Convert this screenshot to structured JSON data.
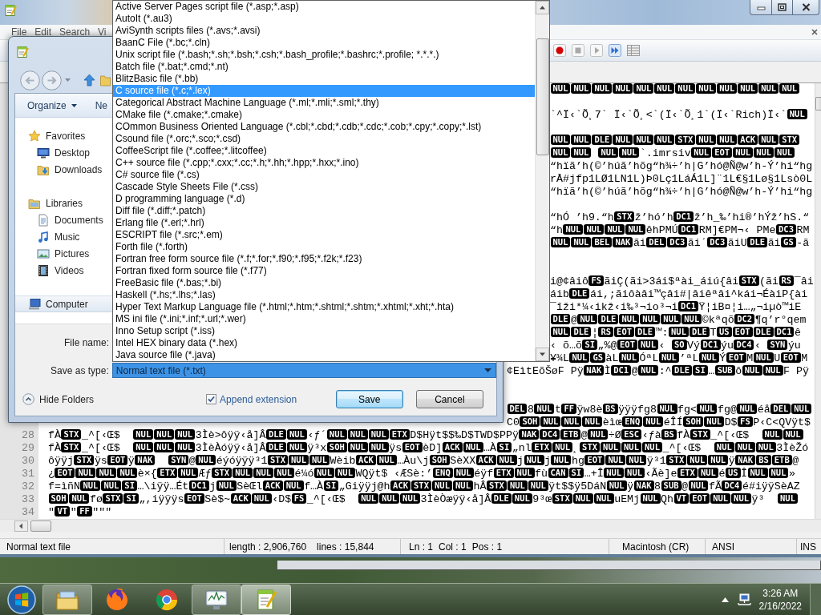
{
  "app": {
    "menu": [
      "File",
      "Edit",
      "Search",
      "Vi"
    ]
  },
  "toolbar": {
    "macro_buttons": [
      {
        "disabled": false
      },
      {
        "disabled": true
      },
      {
        "disabled": true
      },
      {
        "disabled": false
      },
      {
        "disabled": true
      }
    ]
  },
  "editor": {
    "lines": [
      {
        "kind": "code",
        "segments": [
          {
            "kind": "control",
            "text": "NUL"
          },
          {
            "kind": "control",
            "text": "NUL"
          },
          {
            "kind": "control",
            "text": "NUL"
          },
          {
            "kind": "control",
            "text": "NUL"
          },
          {
            "kind": "control",
            "text": "NUL"
          },
          {
            "kind": "control",
            "text": "NUL"
          },
          {
            "kind": "control",
            "text": "NUL"
          },
          {
            "kind": "control",
            "text": "NUL"
          },
          {
            "kind": "control",
            "text": "NUL"
          },
          {
            "kind": "control",
            "text": "NUL"
          },
          {
            "kind": "control",
            "text": "NUL"
          },
          {
            "kind": "control",
            "text": "NUL"
          }
        ]
      },
      {
        "kind": "blank"
      },
      {
        "kind": "code",
        "segments": [
          {
            "kind": "text",
            "text": "`^Ï‹`Õ¸7` Ï‹`Õ¸<`(Ï‹`Õ¸1`(Ï‹`Rich)Ï‹`"
          },
          {
            "kind": "control",
            "text": "NUL"
          }
        ]
      },
      {
        "kind": "blank"
      },
      {
        "kind": "code",
        "segments": [
          {
            "kind": "control",
            "text": "NUL"
          },
          {
            "kind": "control",
            "text": "NUL"
          },
          {
            "kind": "control",
            "text": "DLE"
          },
          {
            "kind": "control",
            "text": "NUL"
          },
          {
            "kind": "control",
            "text": "NUL"
          },
          {
            "kind": "control",
            "text": "NUL"
          },
          {
            "kind": "control",
            "text": "STX"
          },
          {
            "kind": "control",
            "text": "NUL"
          },
          {
            "kind": "control",
            "text": "NUL"
          },
          {
            "kind": "control",
            "text": "ACK"
          },
          {
            "kind": "control",
            "text": "NUL"
          },
          {
            "kind": "control",
            "text": "STX"
          }
        ]
      },
      {
        "kind": "code",
        "segments": [
          {
            "kind": "control",
            "text": "NUL"
          },
          {
            "kind": "control",
            "text": "NUL"
          },
          {
            "kind": "space"
          },
          {
            "kind": "control",
            "text": "NUL"
          },
          {
            "kind": "control",
            "text": "NUL"
          },
          {
            "kind": "text",
            "text": "`.imrsiv"
          },
          {
            "kind": "control",
            "text": "NUL"
          },
          {
            "kind": "control",
            "text": "EOT"
          },
          {
            "kind": "control",
            "text": "NUL"
          },
          {
            "kind": "control",
            "text": "NUL"
          },
          {
            "kind": "control",
            "text": "NUL"
          }
        ]
      },
      {
        "kind": "code",
        "segments": [
          {
            "kind": "text",
            "text": "“hïã’h(©’húã’hõg“h¾÷’h|G’hó@Ñ@w’h-Ý’hi“hg"
          }
        ]
      },
      {
        "kind": "code",
        "segments": [
          {
            "kind": "text",
            "text": "rÅ#jfp1LØ1LN1L)Þ0Lç1LáÁ1L]¨1L€§1Lø§1Lsò0L"
          }
        ]
      },
      {
        "kind": "code",
        "segments": [
          {
            "kind": "text",
            "text": "“hïã’h(©’húã’hõg“h¾÷’h|G’hó@Ñ@w’h-Ý’hi“hg"
          }
        ]
      },
      {
        "kind": "blank"
      },
      {
        "kind": "code",
        "segments": [
          {
            "kind": "text",
            "text": "“hÓ ’h9.“h"
          },
          {
            "kind": "control",
            "text": "STX"
          },
          {
            "kind": "text",
            "text": "ž’hó’h"
          },
          {
            "kind": "control",
            "text": "DC1"
          },
          {
            "kind": "text",
            "text": "ž’h_‰’hi®’hÝž’hS.“"
          }
        ]
      },
      {
        "kind": "code",
        "segments": [
          {
            "kind": "text",
            "text": "“h"
          },
          {
            "kind": "control",
            "text": "NUL"
          },
          {
            "kind": "control",
            "text": "NUL"
          },
          {
            "kind": "control",
            "text": "NUL"
          },
          {
            "kind": "control",
            "text": "NUL"
          },
          {
            "kind": "text",
            "text": "êhPMÚ"
          },
          {
            "kind": "control",
            "text": "DC1"
          },
          {
            "kind": "text",
            "text": "RM]€PM¬‹ PMe"
          },
          {
            "kind": "control",
            "text": "DC3"
          },
          {
            "kind": "text",
            "text": "RM"
          }
        ]
      },
      {
        "kind": "code",
        "segments": [
          {
            "kind": "control",
            "text": "NUL"
          },
          {
            "kind": "control",
            "text": "NUL"
          },
          {
            "kind": "control",
            "text": "BEL"
          },
          {
            "kind": "control",
            "text": "NAK"
          },
          {
            "kind": "text",
            "text": "ãi"
          },
          {
            "kind": "control",
            "text": "DEL"
          },
          {
            "kind": "control",
            "text": "DC3"
          },
          {
            "kind": "text",
            "text": "ãi´"
          },
          {
            "kind": "control",
            "text": "DC3"
          },
          {
            "kind": "text",
            "text": "ãiU"
          },
          {
            "kind": "control",
            "text": "DLE"
          },
          {
            "kind": "text",
            "text": "ãi"
          },
          {
            "kind": "control",
            "text": "GS"
          },
          {
            "kind": "text",
            "text": "-ã"
          }
        ]
      },
      {
        "kind": "blank"
      },
      {
        "kind": "blank"
      },
      {
        "kind": "code",
        "segments": [
          {
            "kind": "text",
            "text": "i@¢âiô"
          },
          {
            "kind": "control",
            "text": "FS"
          },
          {
            "kind": "text",
            "text": "ãiÇ(ãi>3ái$ªài_áiú{âi"
          },
          {
            "kind": "control",
            "text": "STX"
          },
          {
            "kind": "text",
            "text": "(ãi"
          },
          {
            "kind": "control",
            "text": "RS"
          },
          {
            "kind": "text",
            "text": "¯âi"
          }
        ]
      },
      {
        "kind": "code",
        "segments": [
          {
            "kind": "text",
            "text": "áib"
          },
          {
            "kind": "control",
            "text": "DLE"
          },
          {
            "kind": "text",
            "text": "ái,;ãiôàâi™çâi#|âiêªâi^kái¬ÉàiP{ài"
          }
        ]
      },
      {
        "kind": "code",
        "segments": [
          {
            "kind": "text",
            "text": "¯îži*¼‹ikž‹i‰³¬io³¬i"
          },
          {
            "kind": "control",
            "text": "DC1"
          },
          {
            "kind": "text",
            "text": "Ÿ¦iB¤¦i…„¬iµò™iE"
          }
        ]
      },
      {
        "kind": "code",
        "segments": [
          {
            "kind": "control",
            "text": "DLE"
          },
          {
            "kind": "text",
            "text": "@"
          },
          {
            "kind": "control",
            "text": "NUL"
          },
          {
            "kind": "control",
            "text": "DLE"
          },
          {
            "kind": "control",
            "text": "NUL"
          },
          {
            "kind": "control",
            "text": "NUL"
          },
          {
            "kind": "control",
            "text": "NUL"
          },
          {
            "kind": "control",
            "text": "NUL"
          },
          {
            "kind": "text",
            "text": "©kªqõ"
          },
          {
            "kind": "control",
            "text": "DC2"
          },
          {
            "kind": "text",
            "text": "¶q’r°qem"
          }
        ]
      },
      {
        "kind": "code",
        "segments": [
          {
            "kind": "control",
            "text": "NUL"
          },
          {
            "kind": "control",
            "text": "DLE"
          },
          {
            "kind": "text",
            "text": "¦"
          },
          {
            "kind": "control",
            "text": "RS"
          },
          {
            "kind": "control",
            "text": "EOT"
          },
          {
            "kind": "control",
            "text": "DLE"
          },
          {
            "kind": "text",
            "text": "™:"
          },
          {
            "kind": "control",
            "text": "NUL"
          },
          {
            "kind": "control",
            "text": "DLE"
          },
          {
            "kind": "text",
            "text": "T"
          },
          {
            "kind": "control",
            "text": "US"
          },
          {
            "kind": "control",
            "text": "EOT"
          },
          {
            "kind": "control",
            "text": "DLE"
          },
          {
            "kind": "control",
            "text": "DC1"
          },
          {
            "kind": "text",
            "text": "ê"
          }
        ]
      },
      {
        "kind": "code",
        "segments": [
          {
            "kind": "text",
            "text": "‹ õ…õ"
          },
          {
            "kind": "control",
            "text": "SI"
          },
          {
            "kind": "text",
            "text": "„%@"
          },
          {
            "kind": "control",
            "text": "EOT"
          },
          {
            "kind": "control",
            "text": "NUL"
          },
          {
            "kind": "text",
            "text": "‹ "
          },
          {
            "kind": "control",
            "text": "SO"
          },
          {
            "kind": "text",
            "text": "Vý"
          },
          {
            "kind": "control",
            "text": "DC1"
          },
          {
            "kind": "text",
            "text": "ýu"
          },
          {
            "kind": "control",
            "text": "DC4"
          },
          {
            "kind": "text",
            "text": "‹ "
          },
          {
            "kind": "control",
            "text": "SYN"
          },
          {
            "kind": "text",
            "text": "ýu"
          }
        ]
      },
      {
        "kind": "code",
        "segments": [
          {
            "kind": "text",
            "text": "¥¾L"
          },
          {
            "kind": "control",
            "text": "NUL"
          },
          {
            "kind": "control",
            "text": "GS"
          },
          {
            "kind": "text",
            "text": "àL"
          },
          {
            "kind": "control",
            "text": "NUL"
          },
          {
            "kind": "text",
            "text": "ÓªL"
          },
          {
            "kind": "control",
            "text": "NUL"
          },
          {
            "kind": "text",
            "text": "’ªL"
          },
          {
            "kind": "control",
            "text": "NUL"
          },
          {
            "kind": "text",
            "text": "Ý"
          },
          {
            "kind": "control",
            "text": "EOT"
          },
          {
            "kind": "text",
            "text": "M"
          },
          {
            "kind": "control",
            "text": "NUL"
          },
          {
            "kind": "text",
            "text": "U"
          },
          {
            "kind": "control",
            "text": "EOT"
          },
          {
            "kind": "text",
            "text": "M"
          }
        ]
      },
      {
        "kind": "code",
        "segments": [
          {
            "kind": "text",
            "text": "¢EìtEõŠøF Pÿ"
          },
          {
            "kind": "control",
            "text": "NAK"
          },
          {
            "kind": "text",
            "text": "Ì"
          },
          {
            "kind": "control",
            "text": "DC1"
          },
          {
            "kind": "text",
            "text": "@"
          },
          {
            "kind": "control",
            "text": "NUL"
          },
          {
            "kind": "text",
            "text": ":^"
          },
          {
            "kind": "control",
            "text": "DLE"
          },
          {
            "kind": "control",
            "text": "SI"
          },
          {
            "kind": "text",
            "text": "…"
          },
          {
            "kind": "control",
            "text": "SUB"
          },
          {
            "kind": "text",
            "text": "ô"
          },
          {
            "kind": "control",
            "text": "NUL"
          },
          {
            "kind": "control",
            "text": "NUL"
          },
          {
            "kind": "text",
            "text": "F Pÿ"
          }
        ]
      },
      {
        "kind": "blank"
      },
      {
        "kind": "blank"
      },
      {
        "kind": "code",
        "segments": [
          {
            "kind": "control",
            "text": "DEL"
          },
          {
            "kind": "text",
            "text": "8"
          },
          {
            "kind": "control",
            "text": "NUL"
          },
          {
            "kind": "text",
            "text": "t"
          },
          {
            "kind": "control",
            "text": "FF"
          },
          {
            "kind": "text",
            "text": "ÿw8è"
          },
          {
            "kind": "control",
            "text": "BS"
          },
          {
            "kind": "text",
            "text": "ÿÿÿfg8"
          },
          {
            "kind": "control",
            "text": "NUL"
          },
          {
            "kind": "text",
            "text": "fg<"
          },
          {
            "kind": "control",
            "text": "NUL"
          },
          {
            "kind": "text",
            "text": "fg@"
          },
          {
            "kind": "control",
            "text": "NUL"
          },
          {
            "kind": "text",
            "text": "éå"
          },
          {
            "kind": "control",
            "text": "DEL"
          },
          {
            "kind": "control",
            "text": "NUL"
          }
        ]
      },
      {
        "kind": "code",
        "segments": [
          {
            "kind": "text",
            "text": "C0"
          },
          {
            "kind": "control",
            "text": "SOH"
          },
          {
            "kind": "control",
            "text": "NUL"
          },
          {
            "kind": "control",
            "text": "NUL"
          },
          {
            "kind": "control",
            "text": "NUL"
          },
          {
            "kind": "text",
            "text": "èìœ"
          },
          {
            "kind": "control",
            "text": "ENQ"
          },
          {
            "kind": "control",
            "text": "NUL"
          },
          {
            "kind": "text",
            "text": "éÎÍ"
          },
          {
            "kind": "control",
            "text": "SOH"
          },
          {
            "kind": "control",
            "text": "NUL"
          },
          {
            "kind": "text",
            "text": "D$"
          },
          {
            "kind": "control",
            "text": "FS"
          },
          {
            "kind": "text",
            "text": "P‹C<QVÿt$"
          }
        ]
      },
      {
        "kind": "code",
        "number": "28",
        "segments": [
          {
            "kind": "text",
            "text": "fÀ"
          },
          {
            "kind": "control",
            "text": "STX"
          },
          {
            "kind": "text",
            "text": "_^[‹Œ$  "
          },
          {
            "kind": "control",
            "text": "NUL"
          },
          {
            "kind": "control",
            "text": "NUL"
          },
          {
            "kind": "control",
            "text": "NUL"
          },
          {
            "kind": "text",
            "text": "3Ìè>ôÿÿ‹å]Â"
          },
          {
            "kind": "control",
            "text": "DLE"
          },
          {
            "kind": "control",
            "text": "NUL"
          },
          {
            "kind": "text",
            "text": "‹ƒ´"
          },
          {
            "kind": "control",
            "text": "NUL"
          },
          {
            "kind": "control",
            "text": "NUL"
          },
          {
            "kind": "control",
            "text": "NUL"
          },
          {
            "kind": "control",
            "text": "ETX"
          },
          {
            "kind": "text",
            "text": "D$Hÿt$$‰D$TWD$PPÿ"
          },
          {
            "kind": "control",
            "text": "NAK"
          },
          {
            "kind": "control",
            "text": "DC4"
          },
          {
            "kind": "control",
            "text": "ETB"
          },
          {
            "kind": "text",
            "text": "@"
          },
          {
            "kind": "control",
            "text": "NUL"
          },
          {
            "kind": "text",
            "text": "÷Ø"
          },
          {
            "kind": "control",
            "text": "ESC"
          },
          {
            "kind": "text",
            "text": "‹ƒà"
          },
          {
            "kind": "control",
            "text": "BS"
          },
          {
            "kind": "text",
            "text": "fÀ"
          },
          {
            "kind": "control",
            "text": "STX"
          },
          {
            "kind": "text",
            "text": "_^[‹Œ$  "
          },
          {
            "kind": "control",
            "text": "NUL"
          },
          {
            "kind": "control",
            "text": "NUL"
          }
        ]
      },
      {
        "kind": "code",
        "number": "29",
        "segments": [
          {
            "kind": "text",
            "text": "fÀ"
          },
          {
            "kind": "control",
            "text": "STX"
          },
          {
            "kind": "text",
            "text": "_^[‹Œ$  "
          },
          {
            "kind": "control",
            "text": "NUL"
          },
          {
            "kind": "control",
            "text": "NUL"
          },
          {
            "kind": "control",
            "text": "NUL"
          },
          {
            "kind": "text",
            "text": "3ÌèÀóÿÿ‹å]Â"
          },
          {
            "kind": "control",
            "text": "DLE"
          },
          {
            "kind": "control",
            "text": "NUL"
          },
          {
            "kind": "text",
            "text": "ÿ³x"
          },
          {
            "kind": "control",
            "text": "SOH"
          },
          {
            "kind": "control",
            "text": "NUL"
          },
          {
            "kind": "control",
            "text": "NUL"
          },
          {
            "kind": "text",
            "text": "ÿs"
          },
          {
            "kind": "control",
            "text": "EOT"
          },
          {
            "kind": "text",
            "text": "èD]"
          },
          {
            "kind": "control",
            "text": "ACK"
          },
          {
            "kind": "control",
            "text": "NUL"
          },
          {
            "kind": "text",
            "text": "…À"
          },
          {
            "kind": "control",
            "text": "SI"
          },
          {
            "kind": "text",
            "text": "„nl"
          },
          {
            "kind": "control",
            "text": "ETX"
          },
          {
            "kind": "control",
            "text": "NUL"
          },
          {
            "kind": "text",
            "text": "¸"
          },
          {
            "kind": "control",
            "text": "STX"
          },
          {
            "kind": "control",
            "text": "NUL"
          },
          {
            "kind": "control",
            "text": "NUL"
          },
          {
            "kind": "control",
            "text": "NUL"
          },
          {
            "kind": "text",
            "text": "_^[‹Œ$  "
          },
          {
            "kind": "control",
            "text": "NUL"
          },
          {
            "kind": "control",
            "text": "NUL"
          },
          {
            "kind": "control",
            "text": "NUL"
          },
          {
            "kind": "text",
            "text": "3ÌèŽó"
          }
        ]
      },
      {
        "kind": "code",
        "number": "30",
        "segments": [
          {
            "kind": "text",
            "text": "ôÿÿj"
          },
          {
            "kind": "control",
            "text": "STX"
          },
          {
            "kind": "text",
            "text": "ÿs"
          },
          {
            "kind": "control",
            "text": "EOT"
          },
          {
            "kind": "text",
            "text": "ÿ"
          },
          {
            "kind": "control",
            "text": "NAK"
          },
          {
            "kind": "space"
          },
          {
            "kind": "space"
          },
          {
            "kind": "control",
            "text": "SYN"
          },
          {
            "kind": "text",
            "text": "@"
          },
          {
            "kind": "control",
            "text": "NUL"
          },
          {
            "kind": "text",
            "text": "éýóÿÿÿ³1"
          },
          {
            "kind": "control",
            "text": "STX"
          },
          {
            "kind": "control",
            "text": "NUL"
          },
          {
            "kind": "control",
            "text": "NUL"
          },
          {
            "kind": "text",
            "text": "Wèib"
          },
          {
            "kind": "control",
            "text": "ACK"
          },
          {
            "kind": "control",
            "text": "NUL"
          },
          {
            "kind": "text",
            "text": "…Àu\\j"
          },
          {
            "kind": "control",
            "text": "SOH"
          },
          {
            "kind": "text",
            "text": "SèXX"
          },
          {
            "kind": "control",
            "text": "ACK"
          },
          {
            "kind": "control",
            "text": "NUL"
          },
          {
            "kind": "text",
            "text": "j"
          },
          {
            "kind": "control",
            "text": "NUL"
          },
          {
            "kind": "text",
            "text": "j"
          },
          {
            "kind": "control",
            "text": "NUL"
          },
          {
            "kind": "text",
            "text": "hg"
          },
          {
            "kind": "control",
            "text": "EOT"
          },
          {
            "kind": "control",
            "text": "NUL"
          },
          {
            "kind": "control",
            "text": "NUL"
          },
          {
            "kind": "text",
            "text": "ÿ³1"
          },
          {
            "kind": "control",
            "text": "STX"
          },
          {
            "kind": "control",
            "text": "NUL"
          },
          {
            "kind": "control",
            "text": "NUL"
          },
          {
            "kind": "text",
            "text": "ÿ"
          },
          {
            "kind": "control",
            "text": "NAK"
          },
          {
            "kind": "control",
            "text": "BS"
          },
          {
            "kind": "control",
            "text": "ETB"
          },
          {
            "kind": "text",
            "text": "@"
          }
        ]
      },
      {
        "kind": "code",
        "number": "31",
        "segments": [
          {
            "kind": "text",
            "text": "¿"
          },
          {
            "kind": "control",
            "text": "EOT"
          },
          {
            "kind": "control",
            "text": "NUL"
          },
          {
            "kind": "control",
            "text": "NUL"
          },
          {
            "kind": "control",
            "text": "NUL"
          },
          {
            "kind": "text",
            "text": "è×{"
          },
          {
            "kind": "control",
            "text": "ETX"
          },
          {
            "kind": "control",
            "text": "NUL"
          },
          {
            "kind": "text",
            "text": "Æƒ"
          },
          {
            "kind": "control",
            "text": "STX"
          },
          {
            "kind": "control",
            "text": "NUL"
          },
          {
            "kind": "control",
            "text": "NUL"
          },
          {
            "kind": "control",
            "text": "NUL"
          },
          {
            "kind": "text",
            "text": "é¼ó"
          },
          {
            "kind": "control",
            "text": "NUL"
          },
          {
            "kind": "control",
            "text": "NUL"
          },
          {
            "kind": "text",
            "text": "WQÿt$ ‹ÆSè:’"
          },
          {
            "kind": "control",
            "text": "ENQ"
          },
          {
            "kind": "control",
            "text": "NUL"
          },
          {
            "kind": "text",
            "text": "éÿf"
          },
          {
            "kind": "control",
            "text": "ETX"
          },
          {
            "kind": "control",
            "text": "NUL"
          },
          {
            "kind": "text",
            "text": "fù"
          },
          {
            "kind": "control",
            "text": "CAN"
          },
          {
            "kind": "control",
            "text": "SI"
          },
          {
            "kind": "text",
            "text": "…+Î"
          },
          {
            "kind": "control",
            "text": "NUL"
          },
          {
            "kind": "control",
            "text": "NUL"
          },
          {
            "kind": "text",
            "text": "‹Ãè]e"
          },
          {
            "kind": "control",
            "text": "ETX"
          },
          {
            "kind": "control",
            "text": "NUL"
          },
          {
            "kind": "text",
            "text": "é"
          },
          {
            "kind": "control",
            "text": "US"
          },
          {
            "kind": "text",
            "text": "Î"
          },
          {
            "kind": "control",
            "text": "NUL"
          },
          {
            "kind": "control",
            "text": "NUL"
          },
          {
            "kind": "text",
            "text": "»"
          }
        ]
      },
      {
        "kind": "code",
        "number": "32",
        "segments": [
          {
            "kind": "text",
            "text": "f=ìñN"
          },
          {
            "kind": "control",
            "text": "NUL"
          },
          {
            "kind": "control",
            "text": "NUL"
          },
          {
            "kind": "control",
            "text": "SI"
          },
          {
            "kind": "text",
            "text": "…\\iÿÿ…Ét"
          },
          {
            "kind": "control",
            "text": "DC1"
          },
          {
            "kind": "text",
            "text": "j"
          },
          {
            "kind": "control",
            "text": "NUL"
          },
          {
            "kind": "text",
            "text": "SèŒl"
          },
          {
            "kind": "control",
            "text": "ACK"
          },
          {
            "kind": "control",
            "text": "NUL"
          },
          {
            "kind": "text",
            "text": "f…À"
          },
          {
            "kind": "control",
            "text": "SI"
          },
          {
            "kind": "text",
            "text": "„Giÿÿj@h"
          },
          {
            "kind": "control",
            "text": "ACK"
          },
          {
            "kind": "control",
            "text": "STX"
          },
          {
            "kind": "control",
            "text": "NUL"
          },
          {
            "kind": "control",
            "text": "NUL"
          },
          {
            "kind": "text",
            "text": "hÂ"
          },
          {
            "kind": "control",
            "text": "STX"
          },
          {
            "kind": "control",
            "text": "NUL"
          },
          {
            "kind": "control",
            "text": "NUL"
          },
          {
            "kind": "text",
            "text": "ÿt$$ÿ5DáN"
          },
          {
            "kind": "control",
            "text": "NUL"
          },
          {
            "kind": "text",
            "text": "ÿ"
          },
          {
            "kind": "control",
            "text": "NAK"
          },
          {
            "kind": "text",
            "text": "8"
          },
          {
            "kind": "control",
            "text": "SUB"
          },
          {
            "kind": "text",
            "text": "@"
          },
          {
            "kind": "control",
            "text": "NUL"
          },
          {
            "kind": "text",
            "text": "fÃ"
          },
          {
            "kind": "control",
            "text": "DC4"
          },
          {
            "kind": "text",
            "text": "é#iÿÿSèAZ"
          }
        ]
      },
      {
        "kind": "code",
        "number": "33",
        "segments": [
          {
            "kind": "control",
            "text": "SOH"
          },
          {
            "kind": "control",
            "text": "NUL"
          },
          {
            "kind": "text",
            "text": "fø"
          },
          {
            "kind": "control",
            "text": "STX"
          },
          {
            "kind": "control",
            "text": "SI"
          },
          {
            "kind": "text",
            "text": "„,iÿÿÿs"
          },
          {
            "kind": "control",
            "text": "EOT"
          },
          {
            "kind": "text",
            "text": "Sè$~"
          },
          {
            "kind": "control",
            "text": "ACK"
          },
          {
            "kind": "control",
            "text": "NUL"
          },
          {
            "kind": "text",
            "text": "‹D$"
          },
          {
            "kind": "control",
            "text": "FS"
          },
          {
            "kind": "text",
            "text": "_^[‹Œ$  "
          },
          {
            "kind": "control",
            "text": "NUL"
          },
          {
            "kind": "control",
            "text": "NUL"
          },
          {
            "kind": "control",
            "text": "NUL"
          },
          {
            "kind": "text",
            "text": "3ÌèÒæÿÿ‹å]Â"
          },
          {
            "kind": "control",
            "text": "DLE"
          },
          {
            "kind": "control",
            "text": "NUL"
          },
          {
            "kind": "text",
            "text": "9³œ"
          },
          {
            "kind": "control",
            "text": "STX"
          },
          {
            "kind": "control",
            "text": "NUL"
          },
          {
            "kind": "control",
            "text": "NUL"
          },
          {
            "kind": "text",
            "text": "uEMj"
          },
          {
            "kind": "control",
            "text": "NUL"
          },
          {
            "kind": "text",
            "text": "Qh"
          },
          {
            "kind": "control",
            "text": "VT"
          },
          {
            "kind": "control",
            "text": "EOT"
          },
          {
            "kind": "control",
            "text": "NUL"
          },
          {
            "kind": "control",
            "text": "NUL"
          },
          {
            "kind": "text",
            "text": "ÿ³  "
          },
          {
            "kind": "control",
            "text": "NUL"
          }
        ]
      },
      {
        "kind": "code",
        "number": "34",
        "segments": [
          {
            "kind": "text",
            "text": "\""
          },
          {
            "kind": "control",
            "text": "VT"
          },
          {
            "kind": "text",
            "text": "\""
          },
          {
            "kind": "control",
            "text": "FF"
          },
          {
            "kind": "text",
            "text": "\"\"\""
          }
        ]
      }
    ]
  },
  "status_bar": {
    "file_type": "Normal text file",
    "length": "length : 2,906,760",
    "lines": "lines : 15,844",
    "line": "Ln : 1",
    "column": "Col : 1",
    "position": "Pos : 1",
    "eol": "Macintosh (CR)",
    "encoding": "ANSI",
    "mode": "INS"
  },
  "dialog": {
    "organize": "Organize",
    "toolbar_button": "Ne",
    "sidebar": [
      {
        "label": "Favorites",
        "selected": false,
        "children": [
          {
            "label": "Desktop",
            "selected": false
          },
          {
            "label": "Downloads",
            "selected": false
          }
        ]
      },
      {
        "label": "Libraries",
        "selected": false,
        "children": [
          {
            "label": "Documents",
            "selected": false
          },
          {
            "label": "Music",
            "selected": false
          },
          {
            "label": "Pictures",
            "selected": false
          },
          {
            "label": "Videos",
            "selected": false
          }
        ]
      },
      {
        "label": "Computer",
        "selected": true
      }
    ],
    "file_name_label": "File name:",
    "save_type_label": "Save as type:",
    "save_type_value": "Normal text file (*.txt)",
    "file_types": [
      {
        "label": "Active Server Pages script file (*.asp;*.asp)",
        "selected": false
      },
      {
        "label": "AutoIt (*.au3)",
        "selected": false
      },
      {
        "label": "AviSynth scripts files (*.avs;*.avsi)",
        "selected": false
      },
      {
        "label": "BaanC File (*.bc;*.cln)",
        "selected": false
      },
      {
        "label": "Unix script file (*.bash;*.sh;*.bsh;*.csh;*.bash_profile;*.bashrc;*.profile; *.*.*.)",
        "selected": false
      },
      {
        "label": "Batch file (*.bat;*.cmd;*.nt)",
        "selected": false
      },
      {
        "label": "BlitzBasic file (*.bb)",
        "selected": false
      },
      {
        "label": "C source file (*.c;*.lex)",
        "selected": true
      },
      {
        "label": "Categorical Abstract Machine Language (*.ml;*.mli;*.sml;*.thy)",
        "selected": false
      },
      {
        "label": "CMake file (*.cmake;*.cmake)",
        "selected": false
      },
      {
        "label": "COmmon Business Oriented Language (*.cbl;*.cbd;*.cdb;*.cdc;*.cob;*.cpy;*.copy;*.lst)",
        "selected": false
      },
      {
        "label": "Csound file (*.orc;*.sco;*.csd)",
        "selected": false
      },
      {
        "label": "CoffeeScript file (*.coffee;*.litcoffee)",
        "selected": false
      },
      {
        "label": "C++ source file (*.cpp;*.cxx;*.cc;*.h;*.hh;*.hpp;*.hxx;*.ino)",
        "selected": false
      },
      {
        "label": "C# source file (*.cs)",
        "selected": false
      },
      {
        "label": "Cascade Style Sheets File (*.css)",
        "selected": false
      },
      {
        "label": "D programming language (*.d)",
        "selected": false
      },
      {
        "label": "Diff file (*.diff;*.patch)",
        "selected": false
      },
      {
        "label": "Erlang file (*.erl;*.hrl)",
        "selected": false
      },
      {
        "label": "ESCRIPT file (*.src;*.em)",
        "selected": false
      },
      {
        "label": "Forth file (*.forth)",
        "selected": false
      },
      {
        "label": "Fortran free form source file (*.f;*.for;*.f90;*.f95;*.f2k;*.f23)",
        "selected": false
      },
      {
        "label": "Fortran fixed form source file (*.f77)",
        "selected": false
      },
      {
        "label": "FreeBasic file (*.bas;*.bi)",
        "selected": false
      },
      {
        "label": "Haskell (*.hs;*.lhs;*.las)",
        "selected": false
      },
      {
        "label": "Hyper Text Markup Language file (*.html;*.htm;*.shtml;*.shtm;*.xhtml;*.xht;*.hta)",
        "selected": false
      },
      {
        "label": "MS ini file (*.ini;*.inf;*.url;*.wer)",
        "selected": false
      },
      {
        "label": "Inno Setup script (*.iss)",
        "selected": false
      },
      {
        "label": "Intel HEX binary data (*.hex)",
        "selected": false
      },
      {
        "label": "Java source file (*.java)",
        "selected": false
      }
    ],
    "hide_folders": "Hide Folders",
    "append_extension": {
      "label": "Append extension",
      "checked": true
    },
    "buttons": [
      {
        "label": "Save",
        "default": true
      },
      {
        "label": "Cancel",
        "default": false
      }
    ]
  },
  "taskbar": {
    "apps": [
      {
        "running": true,
        "selected": false
      },
      {
        "running": false,
        "selected": false
      },
      {
        "running": false,
        "selected": false
      },
      {
        "running": true,
        "selected": false
      },
      {
        "running": true,
        "selected": true
      }
    ],
    "clock": {
      "time": "3:26 AM",
      "date": "2/16/2022"
    }
  }
}
